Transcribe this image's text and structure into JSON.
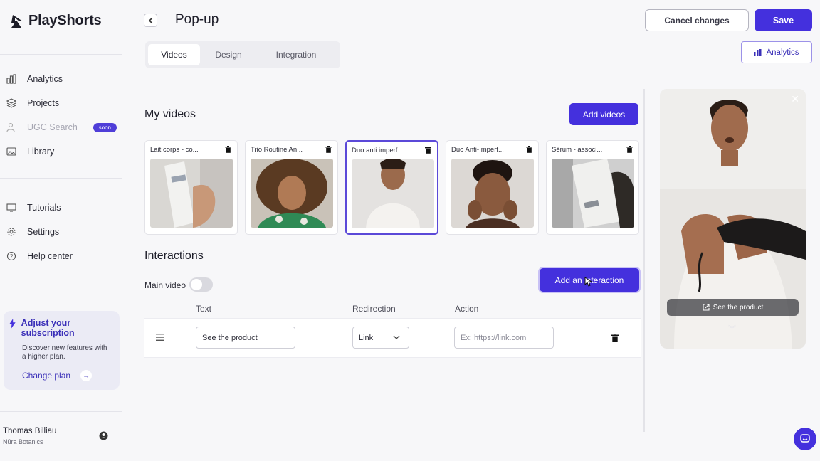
{
  "app": {
    "name": "PlayShorts"
  },
  "sidebar": {
    "items": [
      {
        "label": "Analytics",
        "icon": "bar-chart-icon"
      },
      {
        "label": "Projects",
        "icon": "layers-icon"
      },
      {
        "label": "UGC Search",
        "icon": "person-search-icon",
        "badge": "soon",
        "disabled": true
      },
      {
        "label": "Library",
        "icon": "image-icon"
      },
      {
        "label": "Tutorials",
        "icon": "video-lesson-icon"
      },
      {
        "label": "Settings",
        "icon": "gear-icon"
      },
      {
        "label": "Help center",
        "icon": "help-circle-icon"
      }
    ],
    "promo": {
      "title": "Adjust your subscription",
      "description": "Discover new features with a higher plan.",
      "link": "Change plan"
    },
    "user": {
      "name": "Thomas Billiau",
      "org": "Nūra Botanics"
    }
  },
  "header": {
    "title": "Pop-up",
    "cancel_label": "Cancel changes",
    "save_label": "Save",
    "analytics_label": "Analytics"
  },
  "tabs": [
    {
      "label": "Videos",
      "active": true
    },
    {
      "label": "Design",
      "active": false
    },
    {
      "label": "Integration",
      "active": false
    }
  ],
  "my_videos": {
    "title": "My videos",
    "add_label": "Add videos",
    "items": [
      {
        "title": "Lait corps - co...",
        "selected": false
      },
      {
        "title": "Trio Routine An...",
        "selected": false
      },
      {
        "title": "Duo anti imperf...",
        "selected": true
      },
      {
        "title": "Duo Anti-Imperf...",
        "selected": false
      },
      {
        "title": "Sérum - associ...",
        "selected": false
      }
    ]
  },
  "interactions": {
    "title": "Interactions",
    "main_video_label": "Main video",
    "main_video_on": false,
    "add_label": "Add an interaction",
    "columns": {
      "text": "Text",
      "redirection": "Redirection",
      "action": "Action"
    },
    "rows": [
      {
        "text": "See the product",
        "redirection": "Link",
        "action_placeholder": "Ex: https://link.com"
      }
    ]
  },
  "preview": {
    "cta": "See the product"
  },
  "colors": {
    "accent": "#4430dd",
    "accent_text": "#3a2fb8"
  }
}
